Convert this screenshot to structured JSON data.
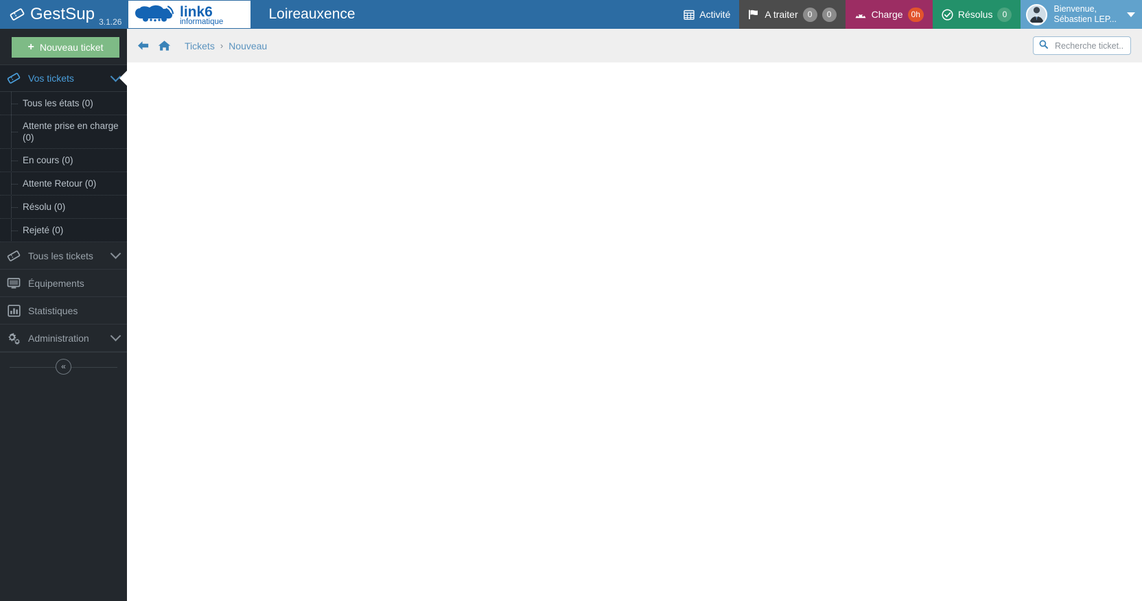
{
  "topbar": {
    "brand_icon": "ticket-diamond-icon",
    "brand_name": "GestSup",
    "version": "3.1.26",
    "logo_text_main": "link6",
    "logo_text_sub": "informatique",
    "site_name": "Loireauxence",
    "items": [
      {
        "id": "activite",
        "icon": "calendar-icon",
        "label": "Activité",
        "badges": []
      },
      {
        "id": "a-traiter",
        "icon": "flag-icon",
        "label": "A traiter",
        "badges": [
          "0",
          "0"
        ]
      },
      {
        "id": "charge",
        "icon": "gauge-icon",
        "label": "Charge",
        "badges": [
          "0h"
        ]
      },
      {
        "id": "resolus",
        "icon": "check-circle-icon",
        "label": "Résolus",
        "badges": [
          "0"
        ]
      }
    ],
    "user": {
      "avatar_icon": "user-avatar-icon",
      "greeting": "Bienvenue,",
      "name": "Sébastien LEP...",
      "caret_icon": "caret-down-icon"
    },
    "colors": {
      "bar": "#2c6ca3",
      "a_traiter": "#4c4c4c",
      "charge": "#9c2d63",
      "resolus": "#23916a",
      "user": "#61a2cc",
      "badge_grey": "#8c8c8c",
      "badge_orange": "#e2542c",
      "badge_green": "#4aa47f"
    }
  },
  "sidebar": {
    "new_ticket": {
      "icon": "plus-icon",
      "label": "Nouveau ticket",
      "color": "#7ebb86"
    },
    "vos_tickets": {
      "icon": "ticket-icon",
      "label": "Vos tickets",
      "chevron": "chevron-down-icon",
      "active": true,
      "children": [
        {
          "label": "Tous les états (0)"
        },
        {
          "label": "Attente prise en charge (0)"
        },
        {
          "label": "En cours (0)"
        },
        {
          "label": "Attente Retour (0)"
        },
        {
          "label": "Résolu (0)"
        },
        {
          "label": "Rejeté (0)"
        }
      ]
    },
    "items": [
      {
        "id": "tous-les-tickets",
        "icon": "ticket-icon",
        "label": "Tous les tickets",
        "chevron": "chevron-down-icon"
      },
      {
        "id": "equipements",
        "icon": "monitor-icon",
        "label": "Équipements",
        "chevron": ""
      },
      {
        "id": "statistiques",
        "icon": "bar-chart-icon",
        "label": "Statistiques",
        "chevron": ""
      },
      {
        "id": "administration",
        "icon": "gears-icon",
        "label": "Administration",
        "chevron": "chevron-down-icon"
      }
    ],
    "collapse": {
      "icon": "double-chevron-left-icon",
      "label": "«"
    }
  },
  "breadcrumb": {
    "back_icon": "arrow-left-icon",
    "home_icon": "home-icon",
    "parent": "Tickets",
    "separator": "›",
    "current": "Nouveau"
  },
  "search": {
    "icon": "search-icon",
    "placeholder": "Recherche ticket...",
    "value": ""
  }
}
